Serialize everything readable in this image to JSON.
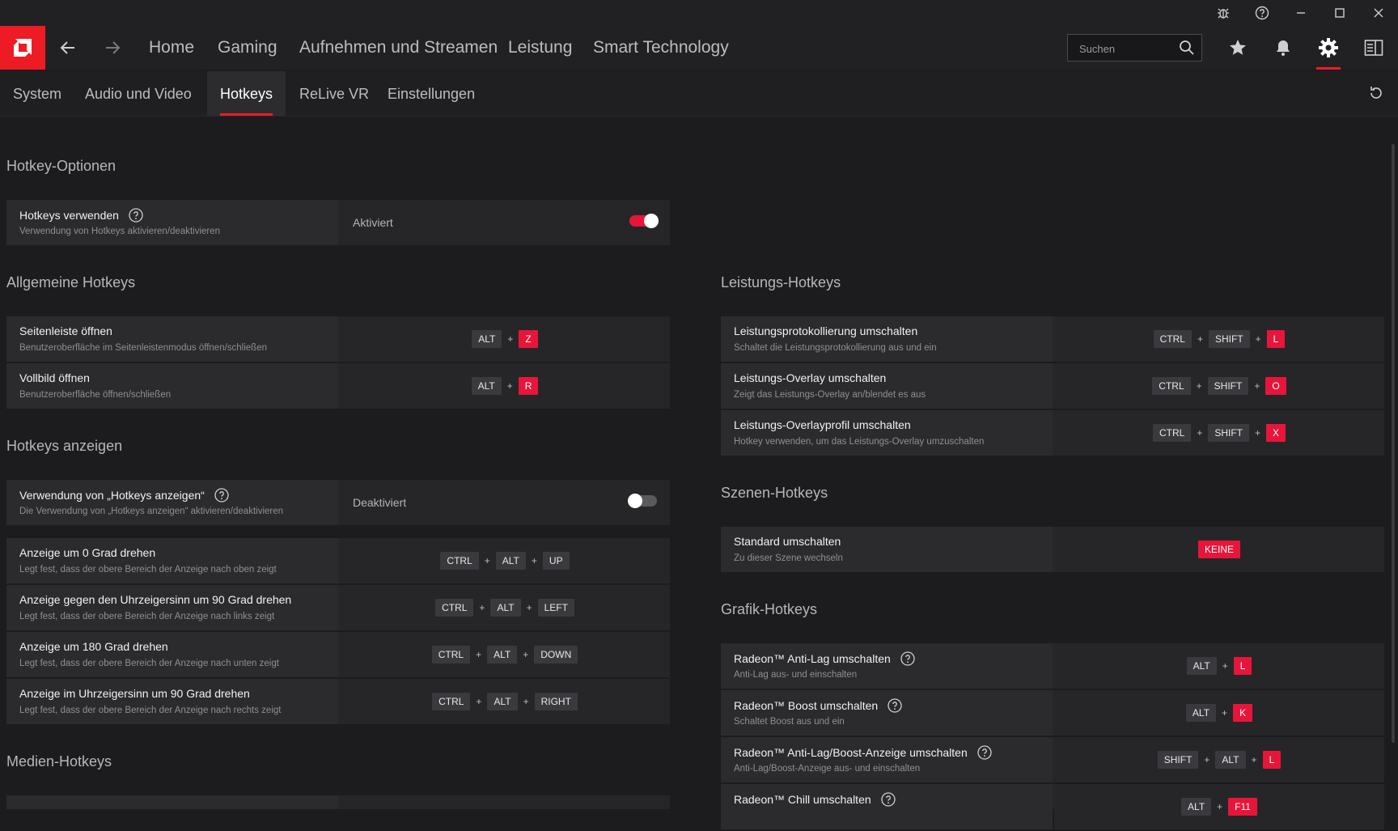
{
  "colors": {
    "accent": "#ed1c24",
    "key_red": "#e8153a",
    "bg": "#1c1c1e"
  },
  "window": {
    "icons": [
      "bug-icon",
      "help-icon",
      "minimize-icon",
      "maximize-icon",
      "close-icon"
    ]
  },
  "nav": {
    "items": [
      "Home",
      "Gaming",
      "Aufnehmen und Streamen",
      "Leistung",
      "Smart Technology"
    ]
  },
  "search": {
    "placeholder": "Suchen"
  },
  "subnav": {
    "tabs": [
      "System",
      "Audio und Video",
      "Hotkeys",
      "ReLive VR",
      "Einstellungen"
    ],
    "active": "Hotkeys"
  },
  "sections": {
    "options": "Hotkey-Optionen",
    "general": "Allgemeine Hotkeys",
    "show": "Hotkeys anzeigen",
    "media": "Medien-Hotkeys",
    "performance": "Leistungs-Hotkeys",
    "scene": "Szenen-Hotkeys",
    "graphics": "Grafik-Hotkeys"
  },
  "options": {
    "title": "Hotkeys verwenden",
    "subtitle": "Verwendung von Hotkeys aktivieren/deaktivieren",
    "status": "Aktiviert",
    "enabled": true
  },
  "general": [
    {
      "title": "Seitenleiste öffnen",
      "subtitle": "Benutzeroberfläche im Seitenleistenmodus öffnen/schließen",
      "keys": [
        "ALT",
        "Z"
      ]
    },
    {
      "title": "Vollbild öffnen",
      "subtitle": "Benutzeroberfläche öffnen/schließen",
      "keys": [
        "ALT",
        "R"
      ]
    }
  ],
  "show": {
    "title": "Verwendung von „Hotkeys anzeigen“",
    "subtitle": "Die Verwendung von „Hotkeys anzeigen“ aktivieren/deaktivieren",
    "status": "Deaktiviert",
    "enabled": false,
    "rows": [
      {
        "title": "Anzeige um 0 Grad drehen",
        "subtitle": "Legt fest, dass der obere Bereich der Anzeige nach oben zeigt",
        "keys": [
          "CTRL",
          "ALT",
          "UP"
        ]
      },
      {
        "title": "Anzeige gegen den Uhrzeigersinn um 90 Grad drehen",
        "subtitle": "Legt fest, dass der obere Bereich der Anzeige nach links zeigt",
        "keys": [
          "CTRL",
          "ALT",
          "LEFT"
        ]
      },
      {
        "title": "Anzeige um 180 Grad drehen",
        "subtitle": "Legt fest, dass der obere Bereich der Anzeige nach unten zeigt",
        "keys": [
          "CTRL",
          "ALT",
          "DOWN"
        ]
      },
      {
        "title": "Anzeige im Uhrzeigersinn um 90 Grad drehen",
        "subtitle": "Legt fest, dass der obere Bereich der Anzeige nach rechts zeigt",
        "keys": [
          "CTRL",
          "ALT",
          "RIGHT"
        ]
      }
    ]
  },
  "performance": [
    {
      "title": "Leistungsprotokollierung umschalten",
      "subtitle": "Schaltet die Leistungsprotokollierung aus und ein",
      "keys": [
        "CTRL",
        "SHIFT",
        "L"
      ]
    },
    {
      "title": "Leistungs-Overlay umschalten",
      "subtitle": "Zeigt das Leistungs-Overlay an/blendet es aus",
      "keys": [
        "CTRL",
        "SHIFT",
        "O"
      ]
    },
    {
      "title": "Leistungs-Overlayprofil umschalten",
      "subtitle": "Hotkey verwenden, um das Leistungs-Overlay umzuschalten",
      "keys": [
        "CTRL",
        "SHIFT",
        "X"
      ]
    }
  ],
  "scene": [
    {
      "title": "Standard umschalten",
      "subtitle": "Zu dieser Szene wechseln",
      "keys": [
        "KEINE"
      ]
    }
  ],
  "graphics": [
    {
      "title": "Radeon™ Anti-Lag umschalten",
      "subtitle": "Anti-Lag aus- und einschalten",
      "keys": [
        "ALT",
        "L"
      ],
      "help": true
    },
    {
      "title": "Radeon™ Boost umschalten",
      "subtitle": "Schaltet Boost aus und ein",
      "keys": [
        "ALT",
        "K"
      ],
      "help": true
    },
    {
      "title": "Radeon™ Anti-Lag/Boost-Anzeige umschalten",
      "subtitle": "Anti-Lag/Boost-Anzeige aus- und einschalten",
      "keys": [
        "SHIFT",
        "ALT",
        "L"
      ],
      "help": true
    },
    {
      "title": "Radeon™ Chill umschalten",
      "subtitle": "",
      "keys": [
        "ALT",
        "F11"
      ],
      "help": true
    }
  ]
}
